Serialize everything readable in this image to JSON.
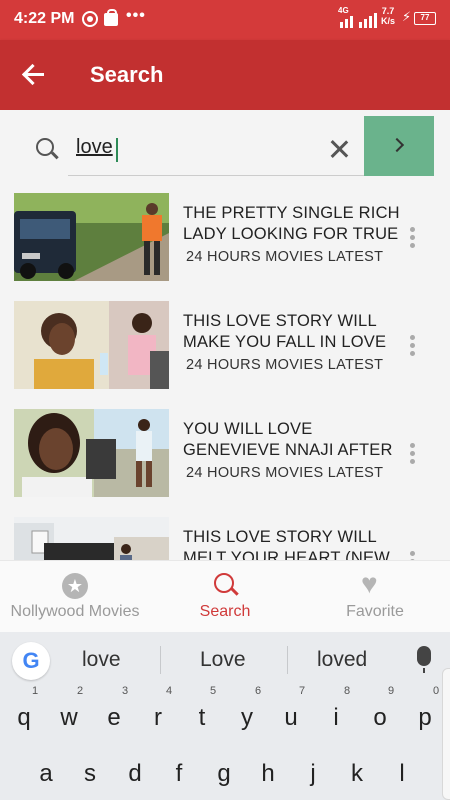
{
  "status_bar": {
    "time": "4:22 PM",
    "network": "4G",
    "speed_top": "7.7",
    "speed_bottom": "K/s",
    "battery": "77"
  },
  "app_bar": {
    "title": "Search"
  },
  "search": {
    "value": "love",
    "colors": {
      "go_button": "#6ab38c"
    }
  },
  "results": [
    {
      "title": "THE PRETTY SINGLE RICH LADY LOOKING FOR TRUE",
      "channel": "24 HOURS MOVIES LATEST"
    },
    {
      "title": "THIS LOVE STORY WILL MAKE YOU FALL IN LOVE",
      "channel": "24 HOURS MOVIES LATEST"
    },
    {
      "title": "YOU WILL LOVE GENEVIEVE NNAJI AFTER",
      "channel": "24 HOURS MOVIES LATEST"
    },
    {
      "title": "THIS LOVE STORY WILL MELT YOUR HEART (NEW",
      "channel": ""
    }
  ],
  "bottom_nav": {
    "items": [
      {
        "label": "Nollywood Movies",
        "icon": "star-icon"
      },
      {
        "label": "Search",
        "icon": "search-icon",
        "active": true
      },
      {
        "label": "Favorite",
        "icon": "heart-icon"
      }
    ],
    "active_color": "#d03a3a"
  },
  "keyboard": {
    "logo": "G",
    "suggestions": [
      "love",
      "Love",
      "loved"
    ],
    "row1": [
      {
        "key": "q",
        "hint": "1"
      },
      {
        "key": "w",
        "hint": "2"
      },
      {
        "key": "e",
        "hint": "3"
      },
      {
        "key": "r",
        "hint": "4"
      },
      {
        "key": "t",
        "hint": "5"
      },
      {
        "key": "y",
        "hint": "6"
      },
      {
        "key": "u",
        "hint": "7"
      },
      {
        "key": "i",
        "hint": "8"
      },
      {
        "key": "o",
        "hint": "9"
      },
      {
        "key": "p",
        "hint": "0"
      }
    ],
    "row2": [
      "a",
      "s",
      "d",
      "f",
      "g",
      "h",
      "j",
      "k",
      "l"
    ]
  },
  "colors": {
    "status_bar": "#d43a3a",
    "app_bar": "#c23030"
  }
}
